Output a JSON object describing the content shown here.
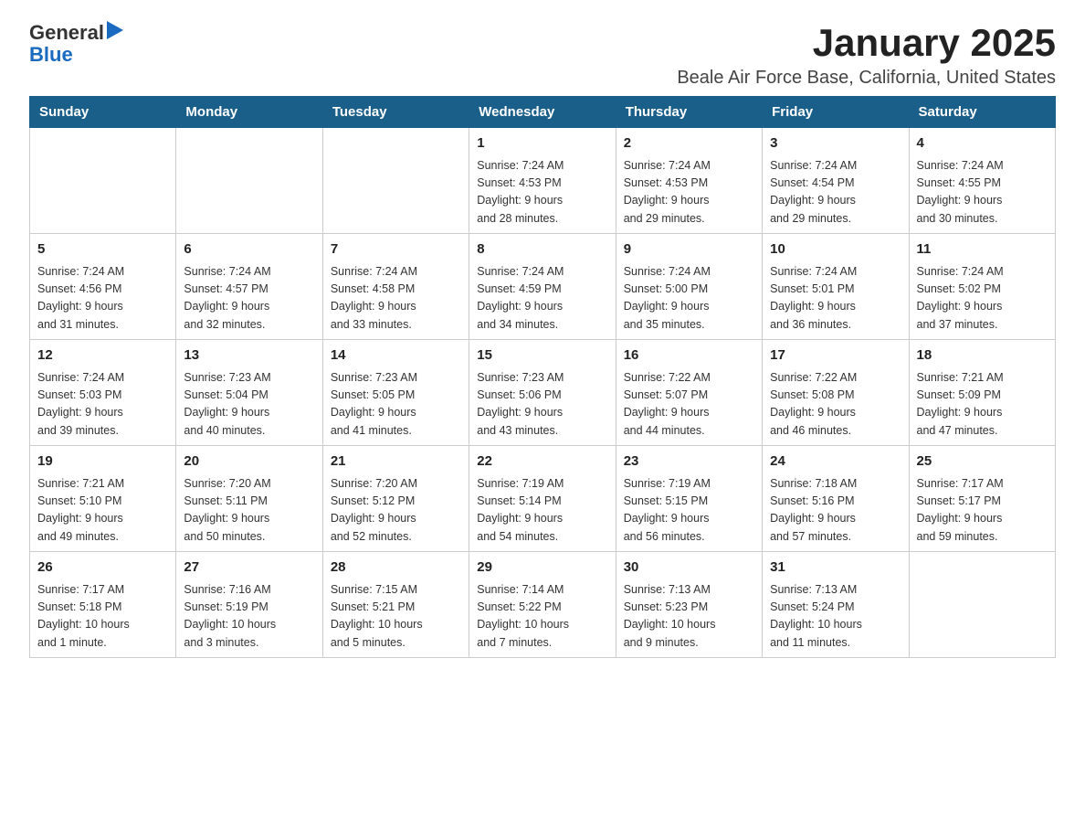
{
  "header": {
    "logo_general": "General",
    "logo_blue": "Blue",
    "title": "January 2025",
    "subtitle": "Beale Air Force Base, California, United States"
  },
  "days_of_week": [
    "Sunday",
    "Monday",
    "Tuesday",
    "Wednesday",
    "Thursday",
    "Friday",
    "Saturday"
  ],
  "weeks": [
    [
      {
        "day": "",
        "info": ""
      },
      {
        "day": "",
        "info": ""
      },
      {
        "day": "",
        "info": ""
      },
      {
        "day": "1",
        "info": "Sunrise: 7:24 AM\nSunset: 4:53 PM\nDaylight: 9 hours\nand 28 minutes."
      },
      {
        "day": "2",
        "info": "Sunrise: 7:24 AM\nSunset: 4:53 PM\nDaylight: 9 hours\nand 29 minutes."
      },
      {
        "day": "3",
        "info": "Sunrise: 7:24 AM\nSunset: 4:54 PM\nDaylight: 9 hours\nand 29 minutes."
      },
      {
        "day": "4",
        "info": "Sunrise: 7:24 AM\nSunset: 4:55 PM\nDaylight: 9 hours\nand 30 minutes."
      }
    ],
    [
      {
        "day": "5",
        "info": "Sunrise: 7:24 AM\nSunset: 4:56 PM\nDaylight: 9 hours\nand 31 minutes."
      },
      {
        "day": "6",
        "info": "Sunrise: 7:24 AM\nSunset: 4:57 PM\nDaylight: 9 hours\nand 32 minutes."
      },
      {
        "day": "7",
        "info": "Sunrise: 7:24 AM\nSunset: 4:58 PM\nDaylight: 9 hours\nand 33 minutes."
      },
      {
        "day": "8",
        "info": "Sunrise: 7:24 AM\nSunset: 4:59 PM\nDaylight: 9 hours\nand 34 minutes."
      },
      {
        "day": "9",
        "info": "Sunrise: 7:24 AM\nSunset: 5:00 PM\nDaylight: 9 hours\nand 35 minutes."
      },
      {
        "day": "10",
        "info": "Sunrise: 7:24 AM\nSunset: 5:01 PM\nDaylight: 9 hours\nand 36 minutes."
      },
      {
        "day": "11",
        "info": "Sunrise: 7:24 AM\nSunset: 5:02 PM\nDaylight: 9 hours\nand 37 minutes."
      }
    ],
    [
      {
        "day": "12",
        "info": "Sunrise: 7:24 AM\nSunset: 5:03 PM\nDaylight: 9 hours\nand 39 minutes."
      },
      {
        "day": "13",
        "info": "Sunrise: 7:23 AM\nSunset: 5:04 PM\nDaylight: 9 hours\nand 40 minutes."
      },
      {
        "day": "14",
        "info": "Sunrise: 7:23 AM\nSunset: 5:05 PM\nDaylight: 9 hours\nand 41 minutes."
      },
      {
        "day": "15",
        "info": "Sunrise: 7:23 AM\nSunset: 5:06 PM\nDaylight: 9 hours\nand 43 minutes."
      },
      {
        "day": "16",
        "info": "Sunrise: 7:22 AM\nSunset: 5:07 PM\nDaylight: 9 hours\nand 44 minutes."
      },
      {
        "day": "17",
        "info": "Sunrise: 7:22 AM\nSunset: 5:08 PM\nDaylight: 9 hours\nand 46 minutes."
      },
      {
        "day": "18",
        "info": "Sunrise: 7:21 AM\nSunset: 5:09 PM\nDaylight: 9 hours\nand 47 minutes."
      }
    ],
    [
      {
        "day": "19",
        "info": "Sunrise: 7:21 AM\nSunset: 5:10 PM\nDaylight: 9 hours\nand 49 minutes."
      },
      {
        "day": "20",
        "info": "Sunrise: 7:20 AM\nSunset: 5:11 PM\nDaylight: 9 hours\nand 50 minutes."
      },
      {
        "day": "21",
        "info": "Sunrise: 7:20 AM\nSunset: 5:12 PM\nDaylight: 9 hours\nand 52 minutes."
      },
      {
        "day": "22",
        "info": "Sunrise: 7:19 AM\nSunset: 5:14 PM\nDaylight: 9 hours\nand 54 minutes."
      },
      {
        "day": "23",
        "info": "Sunrise: 7:19 AM\nSunset: 5:15 PM\nDaylight: 9 hours\nand 56 minutes."
      },
      {
        "day": "24",
        "info": "Sunrise: 7:18 AM\nSunset: 5:16 PM\nDaylight: 9 hours\nand 57 minutes."
      },
      {
        "day": "25",
        "info": "Sunrise: 7:17 AM\nSunset: 5:17 PM\nDaylight: 9 hours\nand 59 minutes."
      }
    ],
    [
      {
        "day": "26",
        "info": "Sunrise: 7:17 AM\nSunset: 5:18 PM\nDaylight: 10 hours\nand 1 minute."
      },
      {
        "day": "27",
        "info": "Sunrise: 7:16 AM\nSunset: 5:19 PM\nDaylight: 10 hours\nand 3 minutes."
      },
      {
        "day": "28",
        "info": "Sunrise: 7:15 AM\nSunset: 5:21 PM\nDaylight: 10 hours\nand 5 minutes."
      },
      {
        "day": "29",
        "info": "Sunrise: 7:14 AM\nSunset: 5:22 PM\nDaylight: 10 hours\nand 7 minutes."
      },
      {
        "day": "30",
        "info": "Sunrise: 7:13 AM\nSunset: 5:23 PM\nDaylight: 10 hours\nand 9 minutes."
      },
      {
        "day": "31",
        "info": "Sunrise: 7:13 AM\nSunset: 5:24 PM\nDaylight: 10 hours\nand 11 minutes."
      },
      {
        "day": "",
        "info": ""
      }
    ]
  ]
}
